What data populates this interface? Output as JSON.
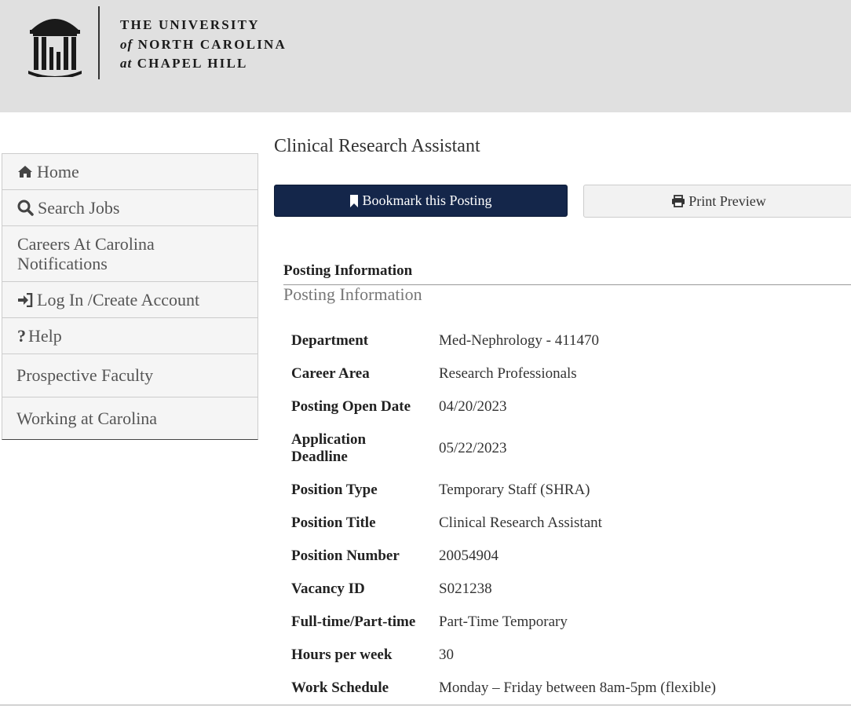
{
  "header": {
    "logo_line1": "THE UNIVERSITY",
    "logo_line2_prefix": "of",
    "logo_line2": "NORTH CAROLINA",
    "logo_line3_prefix": "at",
    "logo_line3": "CHAPEL HILL"
  },
  "sidebar": {
    "items": [
      {
        "label": "Home",
        "icon": "home-icon"
      },
      {
        "label": "Search Jobs",
        "icon": "search-icon"
      },
      {
        "label": "Careers At Carolina Notifications"
      },
      {
        "label": "Log In /Create Account",
        "icon": "sign-in-icon"
      },
      {
        "label": "Help",
        "icon": "question-icon"
      },
      {
        "label": "Prospective Faculty"
      },
      {
        "label": "Working at Carolina"
      }
    ]
  },
  "main": {
    "title": "Clinical Research Assistant",
    "bookmark_label": "Bookmark this Posting",
    "print_label": "Print Preview",
    "section_heading": "Posting Information",
    "section_subheading": "Posting Information"
  },
  "posting": [
    {
      "label": "Department",
      "value": "Med-Nephrology - 411470"
    },
    {
      "label": "Career Area",
      "value": "Research Professionals"
    },
    {
      "label": "Posting Open Date",
      "value": "04/20/2023"
    },
    {
      "label": "Application Deadline",
      "value": "05/22/2023"
    },
    {
      "label": "Position Type",
      "value": "Temporary Staff (SHRA)"
    },
    {
      "label": "Position Title",
      "value": "Clinical Research Assistant"
    },
    {
      "label": "Position Number",
      "value": "20054904"
    },
    {
      "label": "Vacancy ID",
      "value": "S021238"
    },
    {
      "label": "Full-time/Part-time",
      "value": "Part-Time Temporary"
    },
    {
      "label": "Hours per week",
      "value": "30"
    },
    {
      "label": "Work Schedule",
      "value": "Monday – Friday between 8am-5pm (flexible)"
    }
  ],
  "colors": {
    "header_bg": "#e0e0e0",
    "primary_button": "#14264a"
  }
}
